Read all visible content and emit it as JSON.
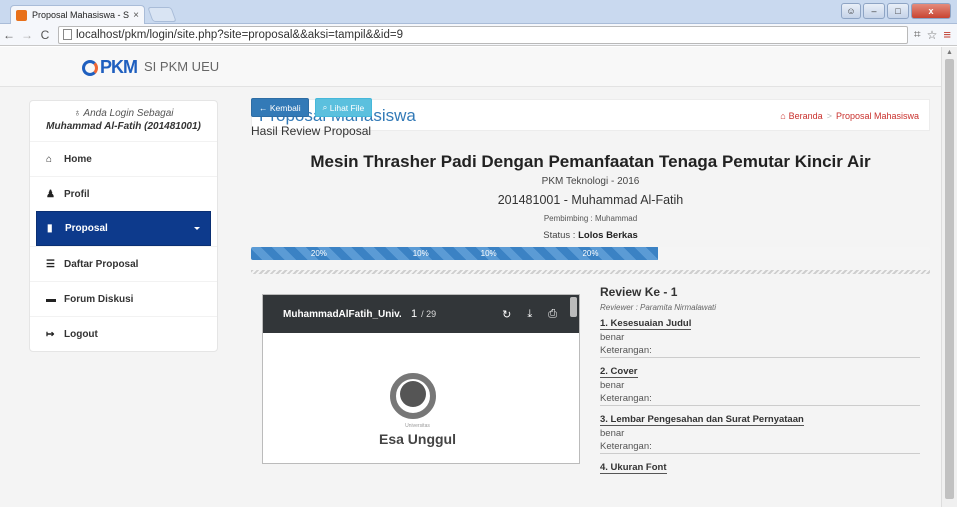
{
  "browser": {
    "tab_title": "Proposal Mahasiswa - SI P",
    "tab_close": "×",
    "url": "localhost/pkm/login/site.php?site=proposal&&aksi=tampil&&id=9",
    "win_close": "x"
  },
  "navbar": {
    "logo_text": "PKM",
    "brand": "SI PKM UEU"
  },
  "sidebar": {
    "login_label": "Anda Login Sebagai",
    "login_name": "Muhammad Al-Fatih (201481001)",
    "items": [
      {
        "label": "Home",
        "icon": "home-icon"
      },
      {
        "label": "Profil",
        "icon": "user-icon"
      },
      {
        "label": "Proposal",
        "icon": "book-icon",
        "active": true
      },
      {
        "label": "Daftar Proposal",
        "icon": "list-icon"
      },
      {
        "label": "Forum Diskusi",
        "icon": "comment-icon"
      },
      {
        "label": "Logout",
        "icon": "logout-icon"
      }
    ]
  },
  "content": {
    "title": "Proposal Mahasiswa",
    "breadcrumb": [
      "Beranda",
      "Proposal Mahasiswa"
    ],
    "buttons": {
      "back": "Kembali",
      "view_file": "Lihat File"
    },
    "review_heading": "Hasil Review Proposal",
    "proposal_title": "Mesin Thrasher Padi Dengan Pemanfaatan Tenaga Pemutar Kincir Air",
    "category": "PKM Teknologi - 2016",
    "student": "201481001 - Muhammad Al-Fatih",
    "supervisor": "Pembimbing : Muhammad",
    "status_label": "Status :",
    "status_value": "Lolos Berkas"
  },
  "progress": [
    {
      "label": "20%",
      "value": 20
    },
    {
      "label": "10%",
      "value": 10
    },
    {
      "label": "10%",
      "value": 10
    },
    {
      "label": "20%",
      "value": 20
    }
  ],
  "pdf_viewer": {
    "file_name": "MuhammadAlFatih_Univ...",
    "page": "1",
    "total": "/ 29",
    "university_small": "Universitas",
    "university_name": "Esa Unggul"
  },
  "review": {
    "title": "Review Ke - 1",
    "reviewer": "Reviewer : Paramita Nirmalawati",
    "criteria": [
      {
        "title": "1. Kesesuaian Judul",
        "value": "benar",
        "note": "Keterangan:"
      },
      {
        "title": "2. Cover",
        "value": "benar",
        "note": "Keterangan:"
      },
      {
        "title": "3. Lembar Pengesahan dan Surat Pernyataan",
        "value": "benar",
        "note": "Keterangan:"
      },
      {
        "title": "4. Ukuran Font",
        "value": "",
        "note": ""
      }
    ]
  },
  "colors": {
    "accent": "#337ab7",
    "sidebar_active": "#0d3a8c",
    "breadcrumb": "#c9302c",
    "info_button": "#5bc0de"
  }
}
